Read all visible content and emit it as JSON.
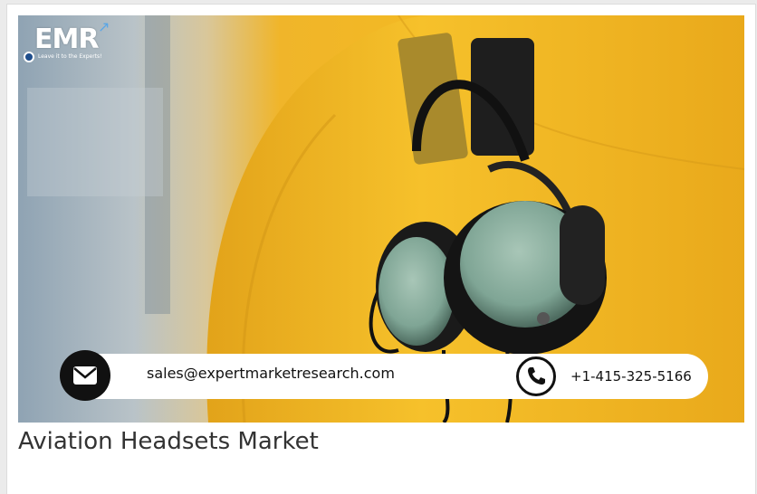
{
  "banner": {
    "logo": {
      "letters": "EMR",
      "tagline": "Leave it to the Experts!"
    },
    "contact": {
      "email": "sales@expertmarketresearch.com",
      "phone": "+1-415-325-5166"
    }
  },
  "article": {
    "title": "Aviation Headsets Market"
  },
  "icons": {
    "email": "envelope-icon",
    "phone": "phone-icon",
    "brand_dot": "logo-dot-icon"
  },
  "colors": {
    "hangar_yellow": "#f4ba22",
    "headset_green": "#8fb4a2",
    "logo_blue": "#1f4e8c",
    "contact_icon_bg": "#111111"
  }
}
